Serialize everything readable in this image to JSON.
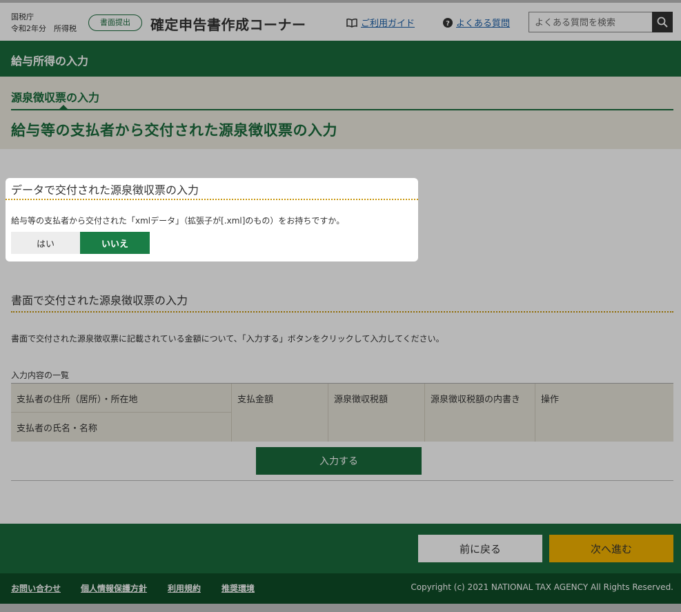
{
  "header": {
    "agency_line1": "国税庁",
    "agency_line2": "令和2年分　所得税",
    "submit_badge": "書面提出",
    "site_title": "確定申告書作成コーナー",
    "guide_link": "ご利用ガイド",
    "faq_link": "よくある質問",
    "search_placeholder": "よくある質問を検索"
  },
  "section_bar": {
    "title": "給与所得の入力"
  },
  "title_area": {
    "sub_title": "源泉徴収票の入力",
    "main_title": "給与等の支払者から交付された源泉徴収票の入力"
  },
  "data_section": {
    "heading": "データで交付された源泉徴収票の入力",
    "question": "給与等の支払者から交付された「xmlデータ」（拡張子が[.xml]のもの）をお持ちですか。",
    "yes_label": "はい",
    "no_label": "いいえ",
    "selected": "いいえ"
  },
  "paper_section": {
    "heading": "書面で交付された源泉徴収票の入力",
    "description": "書面で交付された源泉徴収票に記載されている金額について、「入力する」ボタンをクリックして入力してください。",
    "list_label": "入力内容の一覧",
    "columns": {
      "address": "支払者の住所（居所）・所在地",
      "name": "支払者の氏名・名称",
      "amount": "支払金額",
      "withholding": "源泉徴収税額",
      "breakdown": "源泉徴収税額の内書き",
      "operation": "操作"
    },
    "enter_button": "入力する"
  },
  "footer": {
    "back_button": "前に戻る",
    "next_button": "次へ進む",
    "links": [
      "お問い合わせ",
      "個人情報保護方針",
      "利用規約",
      "推奨環境"
    ],
    "copyright": "Copyright (c) 2021 NATIONAL TAX AGENCY All Rights Reserved."
  },
  "colors": {
    "brand_green": "#1a6b3c",
    "accent_yellow": "#f5b400",
    "dotted_rule": "#c8960a"
  }
}
